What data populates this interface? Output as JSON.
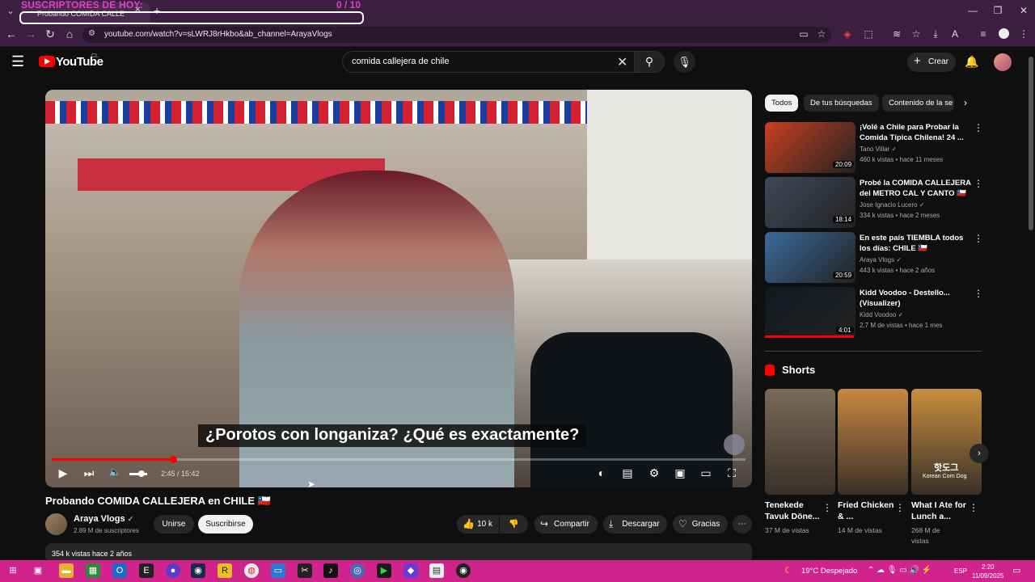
{
  "overlay": {
    "subs_label": "SUSCRIPTORES DE HOY:",
    "count": "0 / 10"
  },
  "browser": {
    "tab_title": "Probando COMIDA CALLE",
    "url": "youtube.com/watch?v=sLWRJ8rHkbo&ab_channel=ArayaVlogs"
  },
  "header": {
    "logo": "YouTube",
    "country": "CL",
    "search_query": "comida callejera de chile",
    "create_label": "Crear"
  },
  "player": {
    "subtitle": "¿Porotos con longaniza? ¿Qué es exactamente?",
    "time": "2:45 / 15:42",
    "progress": 0.175
  },
  "video": {
    "title": "Probando COMIDA CALLEJERA en CHILE 🇨🇱",
    "channel": "Araya Vlogs",
    "subscribers": "2.89 M de suscriptores",
    "join_label": "Unirse",
    "subscribe_label": "Suscribirse",
    "likes": "10 k",
    "share_label": "Compartir",
    "download_label": "Descargar",
    "thanks_label": "Gracias",
    "description_meta": "354 k vistas  hace 2 años"
  },
  "chips": [
    "Todos",
    "De tus búsquedas",
    "Contenido de la se"
  ],
  "recommended": [
    {
      "title": "¡Volé a Chile para Probar la Comida Típica Chilena! 24 ...",
      "channel": "Tano Villar ✓",
      "meta": "460 k vistas • hace 11 meses",
      "duration": "20:09",
      "color": "#c84020"
    },
    {
      "title": "Probé la COMIDA CALLEJERA del METRO CAL Y CANTO 🇨🇱",
      "channel": "Jose Ignacio Lucero ✓",
      "meta": "334 k vistas • hace 2 meses",
      "duration": "18:14",
      "color": "#404858"
    },
    {
      "title": "En este país TIEMBLA todos los días: CHILE 🇨🇱",
      "channel": "Araya Vlogs ✓",
      "meta": "443 k vistas • hace 2 años",
      "duration": "20:59",
      "color": "#3a6a9a"
    },
    {
      "title": "Kidd Voodoo - Destello... (Visualizer)",
      "channel": "Kidd Voodoo ✓",
      "meta": "2.7 M de vistas • hace 1 mes",
      "duration": "4:01",
      "color": "#101820"
    }
  ],
  "shorts": {
    "heading": "Shorts",
    "items": [
      {
        "title": "Tenekede Tavuk Döne...",
        "views": "37 M de vistas",
        "color": "#7a6a58"
      },
      {
        "title": "Fried Chicken & ...",
        "views": "14 M de vistas",
        "color": "#c88840"
      },
      {
        "title": "What I Ate for Lunch a...",
        "views": "268 M de vistas",
        "color": "#c8903c"
      }
    ],
    "thumb_text": "핫도그",
    "thumb_caption": "Korean Corn Dog"
  },
  "taskbar": {
    "weather": "19°C  Despejado",
    "lang": "ESP",
    "time": "2:20",
    "date": "11/09/2025"
  }
}
